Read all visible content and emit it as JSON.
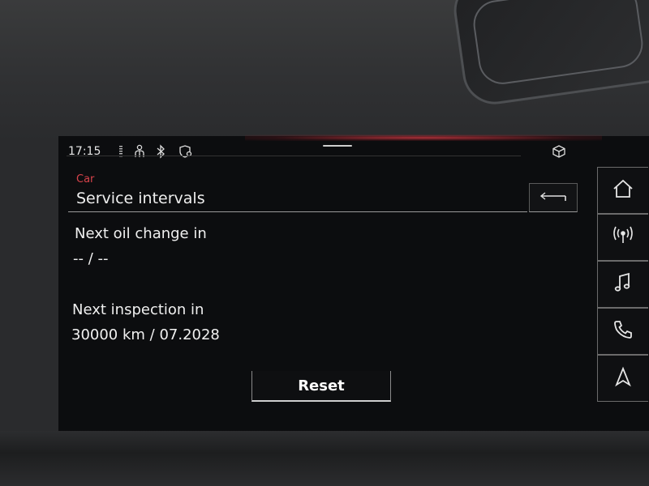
{
  "status_bar": {
    "time": "17:15",
    "icons": [
      "signal-bars-icon",
      "person-icon",
      "bluetooth-icon",
      "shield-location-icon"
    ],
    "right_icon": "cube-icon"
  },
  "header": {
    "breadcrumb": "Car",
    "title": "Service intervals",
    "back_icon": "back-arrow-icon"
  },
  "content": {
    "oil_label": "Next oil change in",
    "oil_value": "-- / --",
    "inspection_label": "Next inspection in",
    "inspection_value": "30000 km / 07.2028"
  },
  "actions": {
    "reset_label": "Reset"
  },
  "side_nav": [
    "home-icon",
    "radio-icon",
    "music-icon",
    "phone-icon",
    "navigation-icon"
  ],
  "colors": {
    "accent": "#d8434b",
    "screen_bg": "#0c0d0f",
    "text": "#f0f0f0"
  }
}
